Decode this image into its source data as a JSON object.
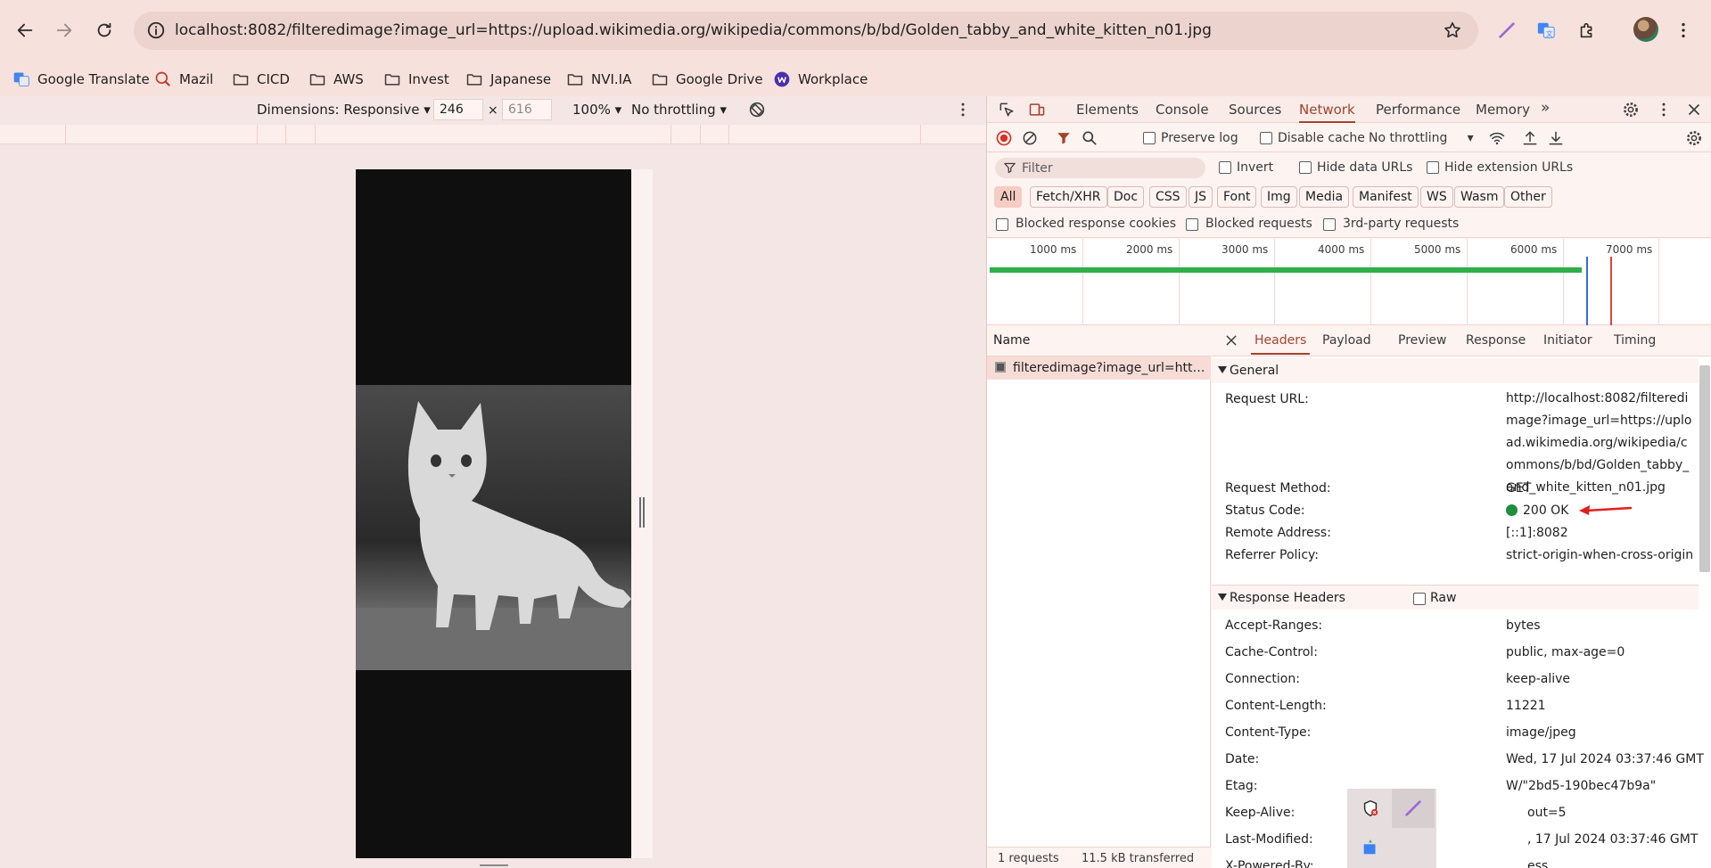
{
  "browser": {
    "url": "localhost:8082/filteredimage?image_url=https://upload.wikimedia.org/wikipedia/commons/b/bd/Golden_tabby_and_white_kitten_n01.jpg",
    "bookmarks": [
      "Google Translate",
      "Mazil",
      "CICD",
      "AWS",
      "Invest",
      "Japanese",
      "NVI.IA",
      "Google Drive",
      "Workplace"
    ]
  },
  "emulation": {
    "dimensions_label": "Dimensions: Responsive",
    "width_value": "246",
    "height_placeholder": "616",
    "zoom": "100%",
    "throttling": "No throttling"
  },
  "devtools": {
    "tabs": [
      "Elements",
      "Console",
      "Sources",
      "Network",
      "Performance",
      "Memory"
    ],
    "active_tab": "Network",
    "preserve_log": "Preserve log",
    "disable_cache": "Disable cache",
    "throttling": "No throttling",
    "filter_placeholder": "Filter",
    "invert": "Invert",
    "hide_data_urls": "Hide data URLs",
    "hide_extension_urls": "Hide extension URLs",
    "type_filters": [
      "All",
      "Fetch/XHR",
      "Doc",
      "CSS",
      "JS",
      "Font",
      "Img",
      "Media",
      "Manifest",
      "WS",
      "Wasm",
      "Other"
    ],
    "blocked_response_cookies": "Blocked response cookies",
    "blocked_requests": "Blocked requests",
    "third_party_requests": "3rd-party requests",
    "timeline_ticks": [
      "1000 ms",
      "2000 ms",
      "3000 ms",
      "4000 ms",
      "5000 ms",
      "6000 ms",
      "7000 ms"
    ],
    "name_header": "Name",
    "request_name": "filteredimage?image_url=https...",
    "footer_requests": "1 requests",
    "footer_transferred": "11.5 kB transferred",
    "detail_tabs": [
      "Headers",
      "Payload",
      "Preview",
      "Response",
      "Initiator",
      "Timing"
    ],
    "general": {
      "title": "General",
      "request_url_key": "Request URL:",
      "request_url": "http://localhost:8082/filteredimage?image_url=https://upload.wikimedia.org/wikipedia/commons/b/bd/Golden_tabby_and_white_kitten_n01.jpg",
      "method_key": "Request Method:",
      "method": "GET",
      "status_key": "Status Code:",
      "status": "200 OK",
      "remote_key": "Remote Address:",
      "remote": "[::1]:8082",
      "referrer_key": "Referrer Policy:",
      "referrer": "strict-origin-when-cross-origin"
    },
    "response_headers": {
      "title": "Response Headers",
      "raw": "Raw",
      "rows": [
        {
          "k": "Accept-Ranges:",
          "v": "bytes"
        },
        {
          "k": "Cache-Control:",
          "v": "public, max-age=0"
        },
        {
          "k": "Connection:",
          "v": "keep-alive"
        },
        {
          "k": "Content-Length:",
          "v": "11221"
        },
        {
          "k": "Content-Type:",
          "v": "image/jpeg"
        },
        {
          "k": "Date:",
          "v": "Wed, 17 Jul 2024 03:37:46 GMT"
        },
        {
          "k": "Etag:",
          "v": "W/\"2bd5-190bec47b9a\""
        },
        {
          "k": "Keep-Alive:",
          "v": "out=5"
        },
        {
          "k": "Last-Modified:",
          "v": ", 17 Jul 2024 03:37:46 GMT"
        },
        {
          "k": "X-Powered-By:",
          "v": "ess"
        }
      ]
    }
  },
  "colors": {
    "accent": "#a2442b",
    "status_ok": "#1e8e3e",
    "timeline_green": "#2fae49",
    "timeline_blue": "#3b6bd6",
    "timeline_red": "#e0443a"
  }
}
